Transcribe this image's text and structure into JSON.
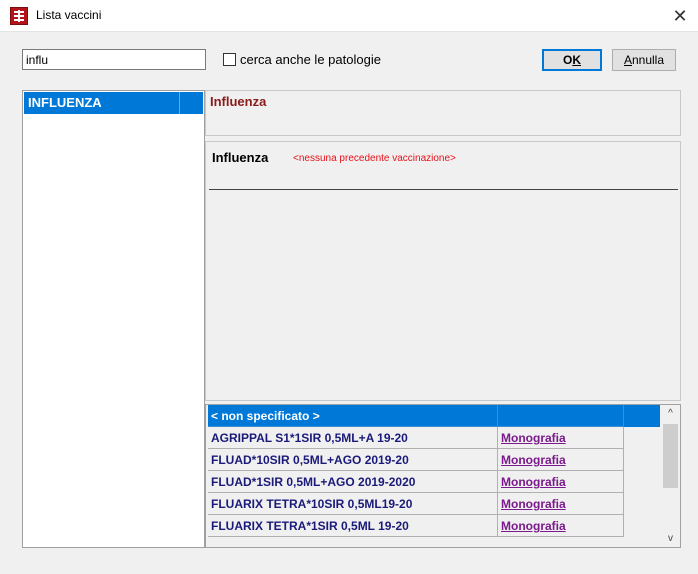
{
  "window": {
    "title": "Lista vaccini",
    "close_glyph": "✕",
    "app_icon": "app-logo-icon"
  },
  "search": {
    "value": "influ",
    "checkbox_label": "cerca anche le patologie",
    "checkbox_checked": false
  },
  "buttons": {
    "ok_prefix": "O",
    "ok_underlined": "K",
    "cancel_underlined": "A",
    "cancel_rest": "nnulla"
  },
  "left_list": {
    "items": [
      {
        "label": "INFLUENZA",
        "selected": true
      }
    ]
  },
  "header": {
    "title": "Influenza"
  },
  "detail": {
    "title": "Influenza",
    "note": "<nessuna precedente vaccinazione>"
  },
  "grid": {
    "rows": [
      {
        "name": "< non specificato >",
        "link": "",
        "selected": true
      },
      {
        "name": "AGRIPPAL  S1*1SIR 0,5ML+A 19-20",
        "link": "Monografia",
        "selected": false
      },
      {
        "name": "FLUAD*10SIR 0,5ML+AGO 2019-20",
        "link": "Monografia",
        "selected": false
      },
      {
        "name": "FLUAD*1SIR 0,5ML+AGO 2019-2020",
        "link": "Monografia",
        "selected": false
      },
      {
        "name": "FLUARIX TETRA*10SIR 0,5ML19-20",
        "link": "Monografia",
        "selected": false
      },
      {
        "name": "FLUARIX TETRA*1SIR 0,5ML 19-20",
        "link": "Monografia",
        "selected": false
      }
    ],
    "scroll_up_glyph": "^",
    "scroll_down_glyph": "v"
  },
  "colors": {
    "selection": "#0078d7",
    "header_title": "#8b1a1a",
    "note": "#e8101a",
    "link": "#7a1a8c",
    "grid_text": "#1a1a7a"
  }
}
